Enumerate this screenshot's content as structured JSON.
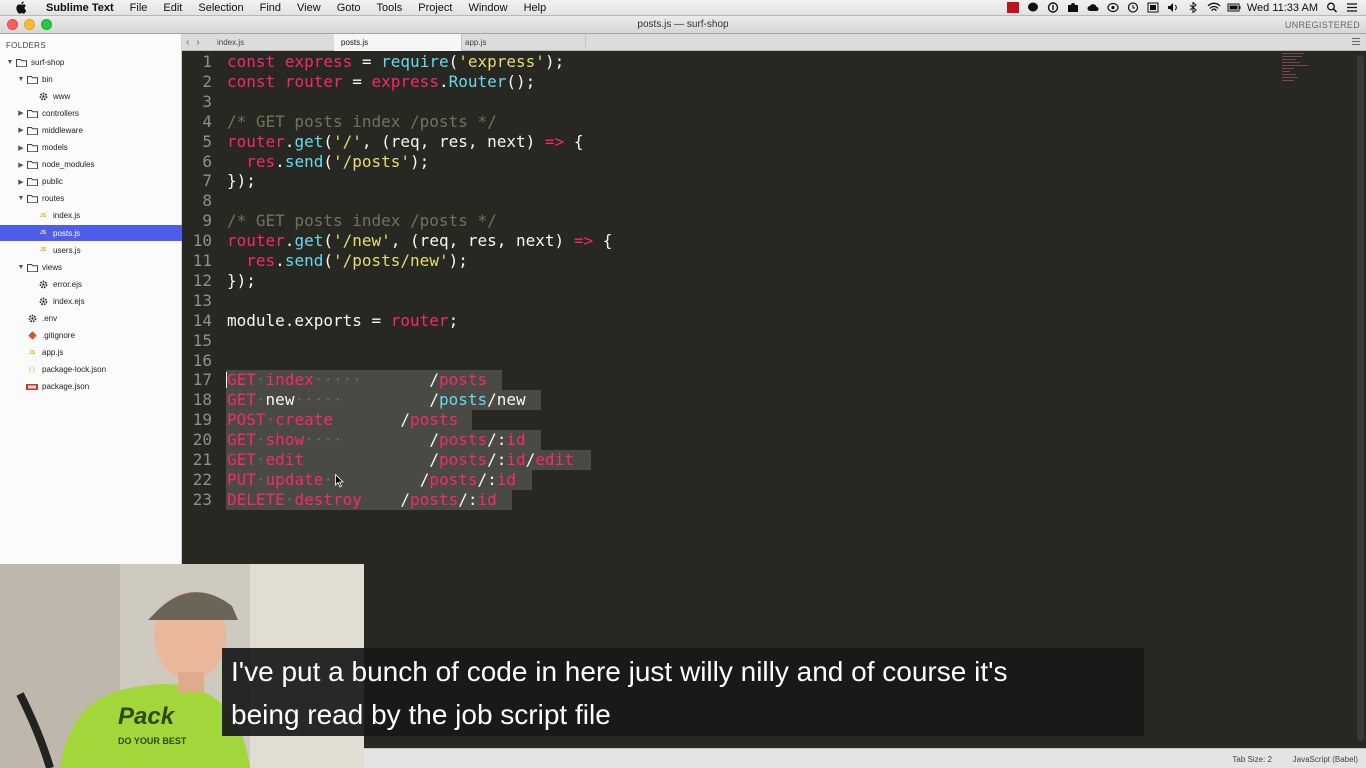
{
  "menubar": {
    "app_name": "Sublime Text",
    "items": [
      "File",
      "Edit",
      "Selection",
      "Find",
      "View",
      "Goto",
      "Tools",
      "Project",
      "Window",
      "Help"
    ],
    "clock": "Wed 11:33 AM"
  },
  "window": {
    "title": "posts.js — surf-shop",
    "license": "UNREGISTERED"
  },
  "sidebar": {
    "header": "FOLDERS",
    "rows": [
      {
        "label": "surf-shop",
        "depth": 0,
        "kind": "folder-open",
        "icon": "folder-icon"
      },
      {
        "label": "bin",
        "depth": 1,
        "kind": "folder-open",
        "icon": "folder-icon"
      },
      {
        "label": "www",
        "depth": 2,
        "kind": "file",
        "icon": "gear-icon"
      },
      {
        "label": "controllers",
        "depth": 1,
        "kind": "folder-closed",
        "icon": "folder-icon"
      },
      {
        "label": "middleware",
        "depth": 1,
        "kind": "folder-closed",
        "icon": "folder-icon"
      },
      {
        "label": "models",
        "depth": 1,
        "kind": "folder-closed",
        "icon": "folder-icon"
      },
      {
        "label": "node_modules",
        "depth": 1,
        "kind": "folder-closed",
        "icon": "folder-icon"
      },
      {
        "label": "public",
        "depth": 1,
        "kind": "folder-closed",
        "icon": "folder-icon"
      },
      {
        "label": "routes",
        "depth": 1,
        "kind": "folder-open",
        "icon": "folder-icon"
      },
      {
        "label": "index.js",
        "depth": 2,
        "kind": "file",
        "icon": "js-icon"
      },
      {
        "label": "posts.js",
        "depth": 2,
        "kind": "file",
        "icon": "js-icon",
        "selected": true
      },
      {
        "label": "users.js",
        "depth": 2,
        "kind": "file",
        "icon": "js-icon"
      },
      {
        "label": "views",
        "depth": 1,
        "kind": "folder-open",
        "icon": "folder-icon"
      },
      {
        "label": "error.ejs",
        "depth": 2,
        "kind": "file",
        "icon": "gear-icon"
      },
      {
        "label": "index.ejs",
        "depth": 2,
        "kind": "file",
        "icon": "gear-icon"
      },
      {
        "label": ".env",
        "depth": 1,
        "kind": "file",
        "icon": "gear-icon"
      },
      {
        "label": ".gitignore",
        "depth": 1,
        "kind": "file",
        "icon": "git-icon"
      },
      {
        "label": "app.js",
        "depth": 1,
        "kind": "file",
        "icon": "js-icon"
      },
      {
        "label": "package-lock.json",
        "depth": 1,
        "kind": "file",
        "icon": "json-icon"
      },
      {
        "label": "package.json",
        "depth": 1,
        "kind": "file",
        "icon": "npm-icon"
      }
    ]
  },
  "tabs": [
    {
      "label": "index.js",
      "active": false
    },
    {
      "label": "posts.js",
      "active": true
    },
    {
      "label": "app.js",
      "active": false
    }
  ],
  "editor": {
    "lines": [
      {
        "n": "1",
        "tokens": [
          [
            "k",
            "const"
          ],
          [
            "w",
            " "
          ],
          [
            "k",
            "express"
          ],
          [
            "w",
            " = "
          ],
          [
            "f",
            "require"
          ],
          [
            "w",
            "("
          ],
          [
            "s",
            "'express'"
          ],
          [
            "w",
            ");"
          ]
        ]
      },
      {
        "n": "2",
        "tokens": [
          [
            "k",
            "const"
          ],
          [
            "w",
            " "
          ],
          [
            "k",
            "router"
          ],
          [
            "w",
            " = "
          ],
          [
            "k",
            "express"
          ],
          [
            "w",
            "."
          ],
          [
            "f",
            "Router"
          ],
          [
            "w",
            "();"
          ]
        ]
      },
      {
        "n": "3",
        "tokens": []
      },
      {
        "n": "4",
        "tokens": [
          [
            "c",
            "/* GET posts index /posts */"
          ]
        ]
      },
      {
        "n": "5",
        "tokens": [
          [
            "k",
            "router"
          ],
          [
            "w",
            "."
          ],
          [
            "f",
            "get"
          ],
          [
            "w",
            "("
          ],
          [
            "s",
            "'/'"
          ],
          [
            "w",
            ", (req, res, next) "
          ],
          [
            "k",
            "=>"
          ],
          [
            "w",
            " {"
          ]
        ]
      },
      {
        "n": "6",
        "tokens": [
          [
            "w",
            "  "
          ],
          [
            "k",
            "res"
          ],
          [
            "w",
            "."
          ],
          [
            "f",
            "send"
          ],
          [
            "w",
            "("
          ],
          [
            "s",
            "'/posts'"
          ],
          [
            "w",
            ");"
          ]
        ]
      },
      {
        "n": "7",
        "tokens": [
          [
            "w",
            "});"
          ]
        ]
      },
      {
        "n": "8",
        "tokens": []
      },
      {
        "n": "9",
        "tokens": [
          [
            "c",
            "/* GET posts index /posts */"
          ]
        ]
      },
      {
        "n": "10",
        "tokens": [
          [
            "k",
            "router"
          ],
          [
            "w",
            "."
          ],
          [
            "f",
            "get"
          ],
          [
            "w",
            "("
          ],
          [
            "s",
            "'/new'"
          ],
          [
            "w",
            ", (req, res, next) "
          ],
          [
            "k",
            "=>"
          ],
          [
            "w",
            " {"
          ]
        ]
      },
      {
        "n": "11",
        "tokens": [
          [
            "w",
            "  "
          ],
          [
            "k",
            "res"
          ],
          [
            "w",
            "."
          ],
          [
            "f",
            "send"
          ],
          [
            "w",
            "("
          ],
          [
            "s",
            "'/posts/new'"
          ],
          [
            "w",
            ");"
          ]
        ]
      },
      {
        "n": "12",
        "tokens": [
          [
            "w",
            "});"
          ]
        ]
      },
      {
        "n": "13",
        "tokens": []
      },
      {
        "n": "14",
        "tokens": [
          [
            "w",
            "module.exports = "
          ],
          [
            "k",
            "router"
          ],
          [
            "w",
            ";"
          ]
        ]
      },
      {
        "n": "15",
        "tokens": []
      },
      {
        "n": "16",
        "tokens": []
      },
      {
        "n": "17",
        "sel": true,
        "tokens": [
          [
            "k",
            "GET"
          ],
          [
            "d",
            "·"
          ],
          [
            "k",
            "index"
          ],
          [
            "d",
            "·····"
          ],
          [
            "t",
            "       "
          ],
          [
            "w",
            "/"
          ],
          [
            "k",
            "posts"
          ]
        ]
      },
      {
        "n": "18",
        "sel": true,
        "tokens": [
          [
            "k",
            "GET"
          ],
          [
            "d",
            "·"
          ],
          [
            "w",
            "new"
          ],
          [
            "d",
            "·····"
          ],
          [
            "t",
            "         "
          ],
          [
            "w",
            "/"
          ],
          [
            "f",
            "posts"
          ],
          [
            "w",
            "/new"
          ]
        ]
      },
      {
        "n": "19",
        "sel": true,
        "tokens": [
          [
            "k",
            "POST"
          ],
          [
            "d",
            "·"
          ],
          [
            "k",
            "create"
          ],
          [
            "t",
            "       "
          ],
          [
            "w",
            "/"
          ],
          [
            "k",
            "posts"
          ]
        ]
      },
      {
        "n": "20",
        "sel": true,
        "tokens": [
          [
            "k",
            "GET"
          ],
          [
            "d",
            "·"
          ],
          [
            "k",
            "show"
          ],
          [
            "d",
            "····"
          ],
          [
            "t",
            "         "
          ],
          [
            "w",
            "/"
          ],
          [
            "k",
            "posts"
          ],
          [
            "w",
            "/:"
          ],
          [
            "k",
            "id"
          ]
        ]
      },
      {
        "n": "21",
        "sel": true,
        "tokens": [
          [
            "k",
            "GET"
          ],
          [
            "d",
            "·"
          ],
          [
            "k",
            "edit"
          ],
          [
            "t",
            "             "
          ],
          [
            "w",
            "/"
          ],
          [
            "k",
            "posts"
          ],
          [
            "w",
            "/:"
          ],
          [
            "k",
            "id"
          ],
          [
            "w",
            "/"
          ],
          [
            "k",
            "edit"
          ]
        ]
      },
      {
        "n": "22",
        "sel": true,
        "tokens": [
          [
            "k",
            "PUT"
          ],
          [
            "d",
            "·"
          ],
          [
            "k",
            "update"
          ],
          [
            "d",
            "·"
          ],
          [
            "t",
            "         "
          ],
          [
            "w",
            "/"
          ],
          [
            "k",
            "posts"
          ],
          [
            "w",
            "/:"
          ],
          [
            "k",
            "id"
          ]
        ]
      },
      {
        "n": "23",
        "sel": true,
        "tokens": [
          [
            "k",
            "DELETE"
          ],
          [
            "d",
            "·"
          ],
          [
            "k",
            "destroy"
          ],
          [
            "t",
            "    "
          ],
          [
            "w",
            "/"
          ],
          [
            "k",
            "posts"
          ],
          [
            "w",
            "/:"
          ],
          [
            "k",
            "id"
          ]
        ]
      }
    ]
  },
  "statusbar": {
    "tab_size": "Tab Size: 2",
    "syntax": "JavaScript (Babel)"
  },
  "subtitle": {
    "line1": "I've put a bunch of code in here just willy nilly and of course it's",
    "line2": "being read by the job script file"
  },
  "webcam": {
    "shirt_text_1": "Pack",
    "shirt_text_2": "DO YOUR BEST"
  },
  "colors": {
    "editor_bg": "#272822",
    "keyword": "#f92672",
    "function": "#66d9ef",
    "string": "#e6db74",
    "comment": "#75715e",
    "selection": "#4a4a44",
    "sidebar_selected": "#4f5ee8"
  }
}
